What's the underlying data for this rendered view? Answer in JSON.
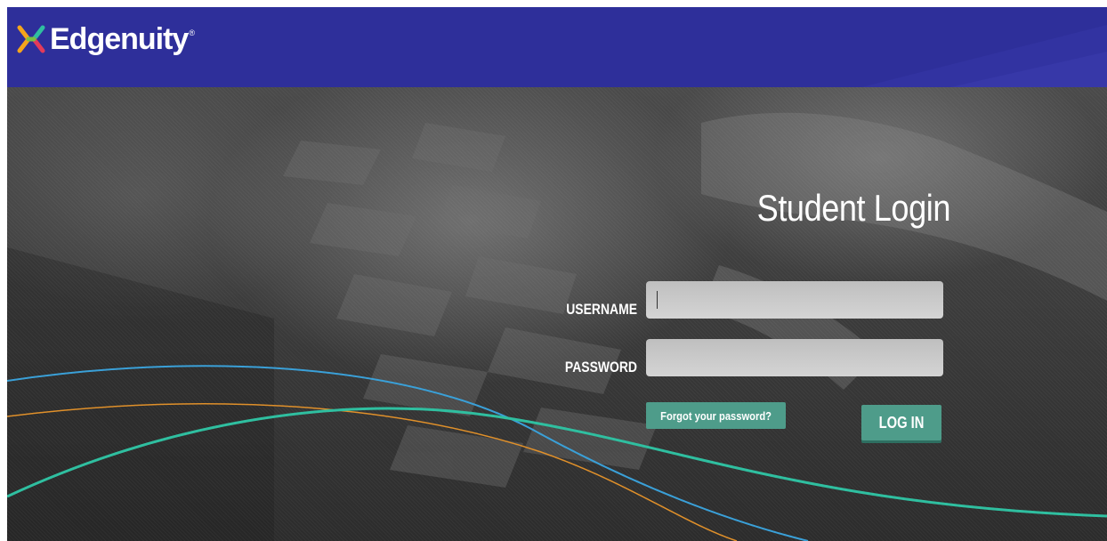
{
  "header": {
    "brand": "Edgenuity",
    "registered_mark": "®"
  },
  "login": {
    "title": "Student Login",
    "username_label": "USERNAME",
    "username_value": "",
    "password_label": "PASSWORD",
    "password_value": "",
    "forgot_label": "Forgot your password?",
    "submit_label": "LOG IN"
  },
  "colors": {
    "header_bg": "#2e2f9a",
    "button_bg": "#4e9c8a",
    "wave_blue": "#3aa0d8",
    "wave_orange": "#e0902a",
    "wave_teal": "#2fbfa0"
  },
  "icons": {
    "logo_mark": "x-logo-mark-icon"
  }
}
